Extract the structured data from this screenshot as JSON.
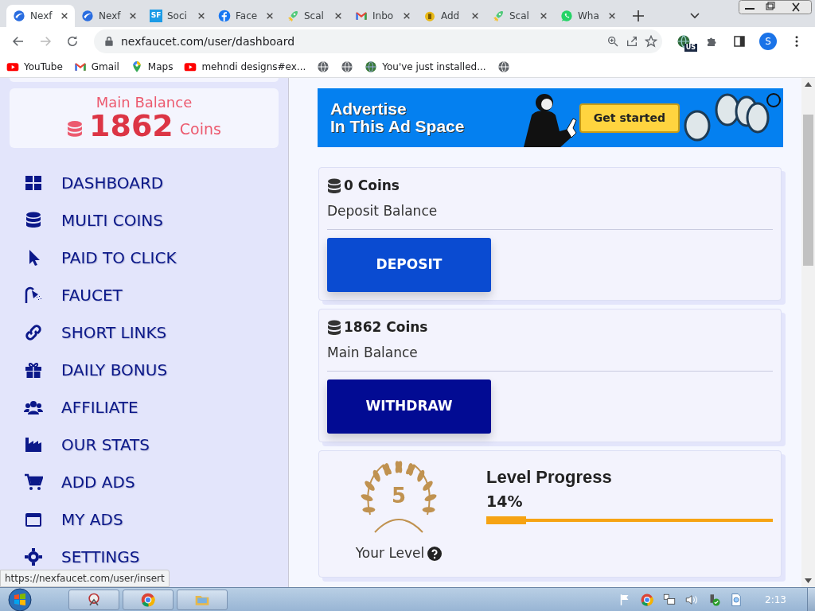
{
  "browser": {
    "tabs": [
      {
        "title": "Nexf",
        "kind": "nexf",
        "selected": true
      },
      {
        "title": "Nexf",
        "kind": "nexf",
        "selected": false
      },
      {
        "title": "Soci",
        "kind": "sf",
        "logo_text": "SF",
        "selected": false
      },
      {
        "title": "Face",
        "kind": "facebook",
        "selected": false
      },
      {
        "title": "Scal",
        "kind": "rocket",
        "selected": false
      },
      {
        "title": "Inbo",
        "kind": "mail",
        "selected": false
      },
      {
        "title": "Add",
        "kind": "coin",
        "selected": false
      },
      {
        "title": "Scal",
        "kind": "rocket",
        "selected": false
      },
      {
        "title": "Wha",
        "kind": "chat",
        "selected": false
      }
    ],
    "address": "nexfaucet.com/user/dashboard",
    "extension_badge": "US",
    "profile_initial": "S",
    "bookmarks": [
      {
        "kind": "video",
        "label": "YouTube"
      },
      {
        "kind": "mail",
        "label": "Gmail"
      },
      {
        "kind": "pin",
        "label": "Maps"
      },
      {
        "kind": "video",
        "label": "mehndi designs#ex..."
      },
      {
        "kind": "globe"
      },
      {
        "kind": "globe"
      },
      {
        "kind": "earth",
        "label": "You've just installed..."
      },
      {
        "kind": "globe"
      }
    ]
  },
  "sidebar": {
    "balance": {
      "label": "Main Balance",
      "amount": "1862",
      "unit": "Coins"
    },
    "menu": [
      {
        "kind": "grid",
        "label": "DASHBOARD"
      },
      {
        "kind": "database",
        "label": "MULTI COINS"
      },
      {
        "kind": "pointer",
        "label": "PAID TO CLICK"
      },
      {
        "kind": "shower",
        "label": "FAUCET"
      },
      {
        "kind": "link",
        "label": "SHORT LINKS"
      },
      {
        "kind": "gift",
        "label": "DAILY BONUS"
      },
      {
        "kind": "users",
        "label": "AFFILIATE"
      },
      {
        "kind": "industry",
        "label": "OUR STATS"
      },
      {
        "kind": "cart",
        "label": "ADD ADS"
      },
      {
        "kind": "window",
        "label": "MY ADS"
      },
      {
        "kind": "gear",
        "label": "SETTINGS"
      }
    ]
  },
  "ad_banner": {
    "headline": "Advertise",
    "subline": "In This Ad Space",
    "button": "Get started"
  },
  "balance_cards": [
    {
      "kind": "deposit",
      "amount": "0 Coins",
      "label": "Deposit Balance",
      "button": "DEPOSIT"
    },
    {
      "kind": "withdraw",
      "amount": "1862 Coins",
      "label": "Main Balance",
      "button": "WITHDRAW"
    }
  ],
  "level_card": {
    "level_number": "5",
    "caption": "Your Level",
    "title": "Level Progress",
    "percent": "14%",
    "level": 0.14
  },
  "status_url": "https://nexfaucet.com/user/insert",
  "taskbar": {
    "clock": "2:13"
  }
}
